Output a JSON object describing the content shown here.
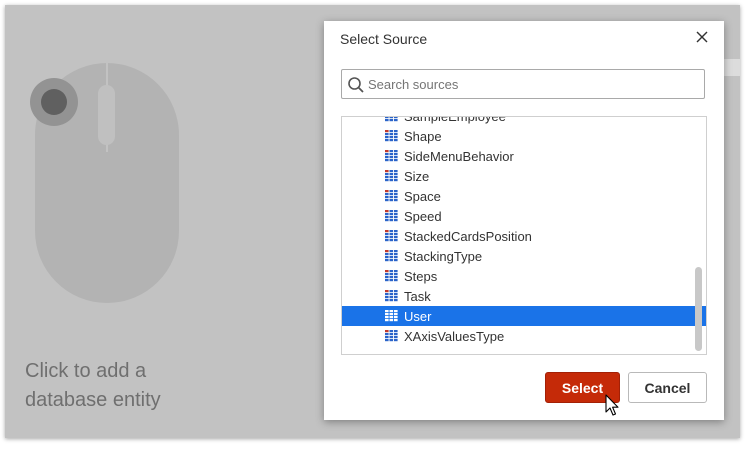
{
  "background": {
    "placeholder_line1": "Click to add a",
    "placeholder_line2": "database entity",
    "illustration": "mouse-icon"
  },
  "dialog": {
    "title": "Select Source",
    "close_icon": "close-icon",
    "search": {
      "placeholder": "Search sources",
      "value": "",
      "icon": "search-icon"
    },
    "items": [
      {
        "label": "SampleEmployee",
        "icon": "entity-icon",
        "selected": false
      },
      {
        "label": "Shape",
        "icon": "entity-icon",
        "selected": false
      },
      {
        "label": "SideMenuBehavior",
        "icon": "entity-icon",
        "selected": false
      },
      {
        "label": "Size",
        "icon": "entity-icon",
        "selected": false
      },
      {
        "label": "Space",
        "icon": "entity-icon",
        "selected": false
      },
      {
        "label": "Speed",
        "icon": "entity-icon",
        "selected": false
      },
      {
        "label": "StackedCardsPosition",
        "icon": "entity-icon",
        "selected": false
      },
      {
        "label": "StackingType",
        "icon": "entity-icon",
        "selected": false
      },
      {
        "label": "Steps",
        "icon": "entity-icon",
        "selected": false
      },
      {
        "label": "Task",
        "icon": "entity-icon",
        "selected": false
      },
      {
        "label": "User",
        "icon": "entity-icon",
        "selected": true
      },
      {
        "label": "XAxisValuesType",
        "icon": "entity-icon",
        "selected": false
      }
    ],
    "select_label": "Select",
    "cancel_label": "Cancel"
  },
  "colors": {
    "primary_button": "#c52a08",
    "selection": "#1a73e8",
    "overlay": "#c2c2c2"
  }
}
